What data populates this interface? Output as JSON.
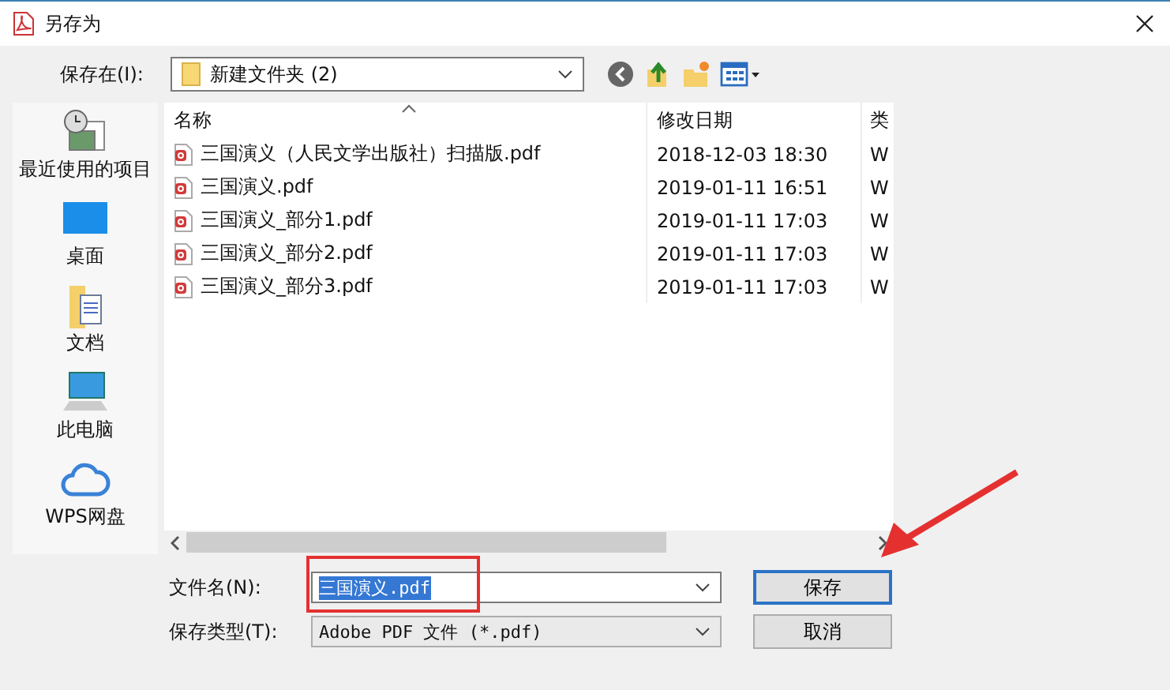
{
  "window": {
    "title": "另存为"
  },
  "save_in": {
    "label": "保存在(I):",
    "value": "新建文件夹 (2)"
  },
  "sidebar": {
    "items": [
      {
        "kind": "recent",
        "label": "最近使用的项目"
      },
      {
        "kind": "desktop",
        "label": "桌面"
      },
      {
        "kind": "documents",
        "label": "文档"
      },
      {
        "kind": "computer",
        "label": "此电脑"
      },
      {
        "kind": "cloud",
        "label": "WPS网盘"
      }
    ]
  },
  "table": {
    "columns": [
      "名称",
      "修改日期",
      "类"
    ],
    "rows": [
      {
        "name": "三国演义（人民文学出版社）扫描版.pdf",
        "date": "2018-12-03 18:30",
        "type": "W"
      },
      {
        "name": "三国演义.pdf",
        "date": "2019-01-11 16:51",
        "type": "W"
      },
      {
        "name": "三国演义_部分1.pdf",
        "date": "2019-01-11 17:03",
        "type": "W"
      },
      {
        "name": "三国演义_部分2.pdf",
        "date": "2019-01-11 17:03",
        "type": "W"
      },
      {
        "name": "三国演义_部分3.pdf",
        "date": "2019-01-11 17:03",
        "type": "W"
      }
    ]
  },
  "file_name": {
    "label": "文件名(N):",
    "value": "三国演义.pdf",
    "selected": true
  },
  "file_type": {
    "label": "保存类型(T):",
    "value": "Adobe PDF 文件 (*.pdf)"
  },
  "buttons": [
    {
      "label": "保存",
      "default": true
    },
    {
      "label": "取消",
      "default": false
    }
  ]
}
